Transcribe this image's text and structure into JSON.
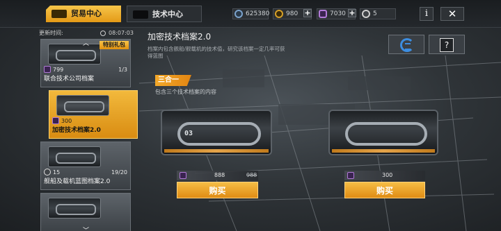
{
  "topbar": {
    "tabs": [
      {
        "label": "贸易中心",
        "active": true
      },
      {
        "label": "技术中心",
        "active": false
      }
    ],
    "currencies": [
      {
        "icon": "credit-icon",
        "value": "625380"
      },
      {
        "icon": "gold-coin-icon",
        "value": "980"
      },
      {
        "icon": "purple-token-icon",
        "value": "7030"
      },
      {
        "icon": "silver-token-icon",
        "value": "5"
      }
    ],
    "info_label": "i",
    "close_label": "✕"
  },
  "update": {
    "label": "更新时间:",
    "time": "08:07:03"
  },
  "list": {
    "items": [
      {
        "tag": "特别礼包",
        "price": "799",
        "count": "1/3",
        "name": "联合技术公司档案"
      },
      {
        "price": "300",
        "name": "加密技术档案2.0",
        "selected": true
      },
      {
        "price": "15",
        "count": "19/20",
        "name": "舰船及载机蓝图档案2.0"
      },
      {
        "name": ""
      }
    ]
  },
  "detail": {
    "title": "加密技术档案2.0",
    "description": "档案内包含舰船/舰载机的技术值，研究该档案一定几率可获得蓝图",
    "help_label": "?",
    "bundle": {
      "tag": "三合一",
      "description": "包含三个技术档案的内容"
    },
    "offers": [
      {
        "crate_label": "03",
        "price": "888",
        "original_price": "988",
        "buy_label": "购买"
      },
      {
        "crate_label": "",
        "price": "300",
        "buy_label": "购买"
      }
    ]
  },
  "colors": {
    "accent_orange": "#e9a02a",
    "panel_dark": "#24282c",
    "purple_currency": "#b27ad8",
    "logo_blue": "#3c8de0"
  }
}
